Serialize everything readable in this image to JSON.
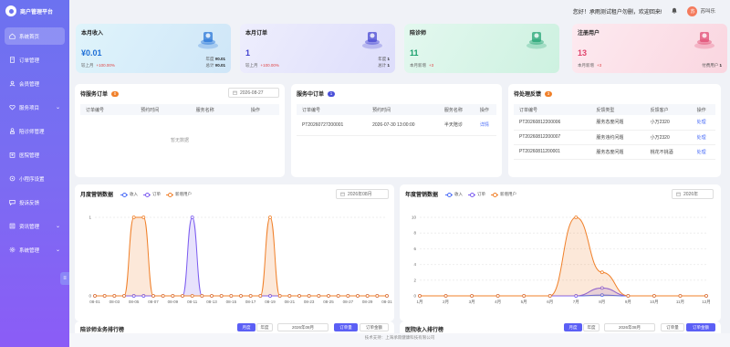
{
  "app": {
    "title": "商户管理平台"
  },
  "sidebar": {
    "items": [
      {
        "label": "系统首页",
        "icon": "home-icon",
        "active": true,
        "has_children": false
      },
      {
        "label": "订单管理",
        "icon": "order-icon",
        "active": false,
        "has_children": false
      },
      {
        "label": "会员管理",
        "icon": "member-icon",
        "active": false,
        "has_children": false
      },
      {
        "label": "服务项目",
        "icon": "heart-icon",
        "active": false,
        "has_children": true
      },
      {
        "label": "陪诊师管理",
        "icon": "staff-icon",
        "active": false,
        "has_children": false
      },
      {
        "label": "医院管理",
        "icon": "hospital-icon",
        "active": false,
        "has_children": false
      },
      {
        "label": "小程序设置",
        "icon": "miniapp-icon",
        "active": false,
        "has_children": false
      },
      {
        "label": "投诉反馈",
        "icon": "feedback-icon",
        "active": false,
        "has_children": false
      },
      {
        "label": "资讯管理",
        "icon": "news-icon",
        "active": false,
        "has_children": true
      },
      {
        "label": "系统管理",
        "icon": "settings-icon",
        "active": false,
        "has_children": true
      }
    ],
    "collapse_icon": "menu-collapse-icon"
  },
  "header": {
    "welcome": "您好！承雨测试租户勿删，欢迎回来!",
    "bell_icon": "bell-icon",
    "avatar_text": "苏",
    "username": "苏叫乐"
  },
  "stats": [
    {
      "title": "本月收入",
      "value": "¥0.01",
      "foot_label": "较上月",
      "foot_change": "+100.00%",
      "side": [
        [
          "年度",
          "¥0.01"
        ],
        [
          "总计",
          "¥0.01"
        ]
      ],
      "color": "#1f6fd6"
    },
    {
      "title": "本月订单",
      "value": "1",
      "foot_label": "较上月",
      "foot_change": "+100.00%",
      "side": [
        [
          "年度",
          "1"
        ],
        [
          "总计",
          "1"
        ]
      ],
      "color": "#3f3fd0"
    },
    {
      "title": "陪诊师",
      "value": "11",
      "foot_label": "本月新增",
      "foot_change": "+3",
      "side": [],
      "color": "#1aa06d"
    },
    {
      "title": "注册用户",
      "value": "13",
      "foot_label": "本月新增",
      "foot_change": "+3",
      "side": [
        [
          "付费用户",
          "1"
        ]
      ],
      "color": "#e0456d"
    }
  ],
  "pending_orders": {
    "title": "待服务订单",
    "badge": "0",
    "date": "2026-08-27",
    "columns": [
      "订单编号",
      "预约时间",
      "服务名称",
      "操作"
    ],
    "empty_text": "暂无数据"
  },
  "in_service": {
    "title": "服务中订单",
    "badge": "1",
    "columns": [
      "订单编号",
      "预约时间",
      "服务名称",
      "操作"
    ],
    "rows": [
      {
        "id": "PT20260727200001",
        "time": "2026-07-30 13:00:00",
        "service": "半天陪诊",
        "action": "详情"
      }
    ]
  },
  "feedback": {
    "title": "待处理反馈",
    "badge": "3",
    "columns": [
      "订单编号",
      "反馈类型",
      "反馈客户",
      "操作"
    ],
    "rows": [
      {
        "id": "PT20260812200006",
        "type": "服务态度问题",
        "customer": "小万2320",
        "action": "处理"
      },
      {
        "id": "PT20260812200007",
        "type": "服务违约问题",
        "customer": "小万2320",
        "action": "处理"
      },
      {
        "id": "PT20260811200001",
        "type": "服务态度问题",
        "customer": "桃花不挑酒",
        "action": "处理"
      }
    ]
  },
  "monthly_chart_panel": {
    "title": "月度营销数据",
    "date": "2026年08月"
  },
  "yearly_chart_panel": {
    "title": "年度营销数据",
    "date": "2026年"
  },
  "chart_data": [
    {
      "type": "area",
      "title": "月度营销数据",
      "ylim": [
        0,
        1
      ],
      "yticks": [
        "0",
        "1"
      ],
      "categories": [
        "08-01",
        "08-02",
        "08-03",
        "08-04",
        "08-05",
        "08-06",
        "08-07",
        "08-08",
        "08-09",
        "08-10",
        "08-11",
        "08-12",
        "08-13",
        "08-14",
        "08-15",
        "08-16",
        "08-17",
        "08-18",
        "08-19",
        "08-20",
        "08-21",
        "08-22",
        "08-23",
        "08-24",
        "08-25",
        "08-26",
        "08-27",
        "08-28",
        "08-29",
        "08-30",
        "08-31"
      ],
      "series": [
        {
          "name": "收入",
          "color": "#4a6cf7",
          "values": [
            0,
            0,
            0,
            0,
            0,
            0,
            0,
            0,
            0,
            0,
            0,
            0,
            0,
            0,
            0,
            0,
            0,
            0,
            0,
            0,
            0,
            0,
            0,
            0,
            0,
            0,
            0,
            0,
            0,
            0,
            0
          ]
        },
        {
          "name": "订单",
          "color": "#7c5cf0",
          "values": [
            0,
            0,
            0,
            0,
            0,
            0,
            0,
            0,
            0,
            0,
            1,
            0,
            0,
            0,
            0,
            0,
            0,
            0,
            0,
            0,
            0,
            0,
            0,
            0,
            0,
            0,
            0,
            0,
            0,
            0,
            0
          ]
        },
        {
          "name": "新增用户",
          "color": "#f0802a",
          "values": [
            0,
            0,
            0,
            0,
            1,
            1,
            0,
            0,
            0,
            0,
            0,
            0,
            0,
            0,
            0,
            0,
            0,
            0,
            1,
            0,
            0,
            0,
            0,
            0,
            0,
            0,
            0,
            0,
            0,
            0,
            0
          ]
        }
      ],
      "xlabels_shown": [
        "08-01",
        "08-03",
        "08-05",
        "08-07",
        "08-09",
        "08-11",
        "08-13",
        "08-15",
        "08-17",
        "08-19",
        "08-21",
        "08-23",
        "08-25",
        "08-27",
        "08-29",
        "08-31"
      ]
    },
    {
      "type": "area",
      "title": "年度营销数据",
      "ylim": [
        0,
        10
      ],
      "yticks": [
        "0",
        "2",
        "4",
        "6",
        "8",
        "10"
      ],
      "categories": [
        "1月",
        "2月",
        "3月",
        "4月",
        "5月",
        "6月",
        "7月",
        "8月",
        "9月",
        "10月",
        "11月",
        "12月"
      ],
      "series": [
        {
          "name": "收入",
          "color": "#4a6cf7",
          "values": [
            0,
            0,
            0,
            0,
            0,
            0,
            0,
            0.1,
            0,
            0,
            0,
            0
          ]
        },
        {
          "name": "订单",
          "color": "#7c5cf0",
          "values": [
            0,
            0,
            0,
            0,
            0,
            0,
            0,
            1,
            0,
            0,
            0,
            0
          ]
        },
        {
          "name": "新增用户",
          "color": "#f0802a",
          "values": [
            0,
            0,
            0,
            0,
            0,
            0,
            10,
            3,
            0,
            0,
            0,
            0
          ]
        }
      ]
    }
  ],
  "bottom_left": {
    "title": "陪诊师业务排行榜",
    "btn1": "月度",
    "btn2": "年度",
    "date": "2026年08月",
    "btn3": "订单量",
    "btn4": "订单金额"
  },
  "bottom_right": {
    "title": "医院收入排行榜",
    "btn1": "月度",
    "btn2": "年度",
    "date": "2026年08月",
    "btn3": "订单量",
    "btn4": "订单金额"
  },
  "footer": {
    "text": "技术支持：上海承雨健康科技有限公司"
  }
}
